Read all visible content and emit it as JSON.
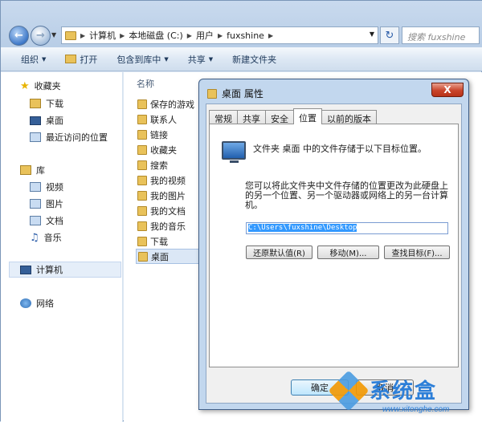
{
  "address": {
    "crumbs": [
      "计算机",
      "本地磁盘 (C:)",
      "用户",
      "fuxshine"
    ],
    "search_placeholder": "搜索 fuxshine"
  },
  "toolbar": {
    "organize": "组织",
    "open": "打开",
    "include_library": "包含到库中",
    "share": "共享",
    "new_folder": "新建文件夹"
  },
  "navpane": {
    "favorites": "收藏夹",
    "downloads": "下载",
    "desktop": "桌面",
    "recent": "最近访问的位置",
    "libraries": "库",
    "videos": "视频",
    "pictures": "图片",
    "documents": "文档",
    "music": "音乐",
    "computer": "计算机",
    "network": "网络"
  },
  "filelist": {
    "header_name": "名称",
    "items": [
      "保存的游戏",
      "联系人",
      "链接",
      "收藏夹",
      "搜索",
      "我的视频",
      "我的图片",
      "我的文档",
      "我的音乐",
      "下载",
      "桌面"
    ]
  },
  "dialog": {
    "title": "桌面 属性",
    "close": "X",
    "tabs": [
      "常规",
      "共享",
      "安全",
      "位置",
      "以前的版本"
    ],
    "info1": "文件夹 桌面 中的文件存储于以下目标位置。",
    "info2": "您可以将此文件夹中文件存储的位置更改为此硬盘上的另一个位置、另一个驱动器或网络上的另一台计算机。",
    "path": "C:\\Users\\fuxshine\\Desktop",
    "restore_default": "还原默认值(R)",
    "move": "移动(M)...",
    "find_target": "查找目标(F)...",
    "ok": "确定",
    "cancel": "取消"
  },
  "watermark": {
    "text": "系统盒",
    "url": "www.xitonghe.com"
  }
}
